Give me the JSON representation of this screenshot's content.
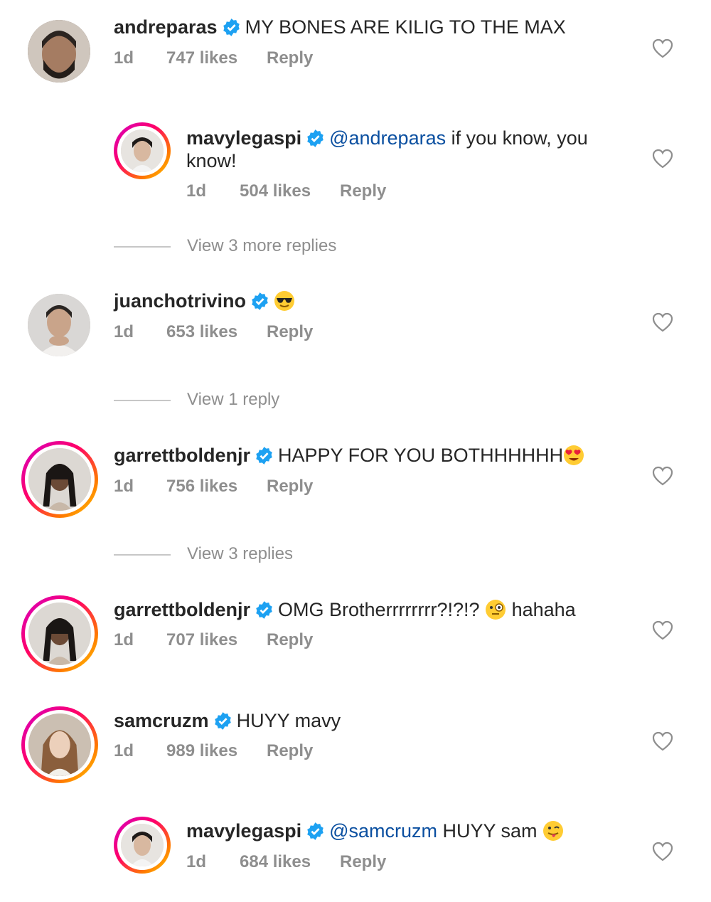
{
  "comments": [
    {
      "username": "andreparas",
      "text": "MY BONES ARE KILIG TO THE MAX",
      "time": "1d",
      "likes": "747 likes",
      "reply": "Reply",
      "avatar": "avatar-andreparas"
    },
    {
      "username": "mavylegaspi",
      "mention": "@andreparas",
      "text": " if you know, you know!",
      "time": "1d",
      "likes": "504 likes",
      "reply": "Reply",
      "avatar": "avatar-mavylegaspi"
    },
    {
      "username": "juanchotrivino",
      "emoji": "sunglasses-emoji",
      "time": "1d",
      "likes": "653 likes",
      "reply": "Reply",
      "avatar": "avatar-juanchotrivino"
    },
    {
      "username": "garrettboldenjr",
      "text": "HAPPY FOR YOU BOTHHHHHH",
      "emoji": "heart-eyes-emoji",
      "time": "1d",
      "likes": "756 likes",
      "reply": "Reply",
      "avatar": "avatar-garrettboldenjr"
    },
    {
      "username": "garrettboldenjr",
      "text": "OMG Brotherrrrrrrr?!?!? ",
      "emoji": "monocle-emoji",
      "text2": " hahaha",
      "time": "1d",
      "likes": "707 likes",
      "reply": "Reply",
      "avatar": "avatar-garrettboldenjr"
    },
    {
      "username": "samcruzm",
      "text": "HUYY mavy",
      "time": "1d",
      "likes": "989 likes",
      "reply": "Reply",
      "avatar": "avatar-samcruzm"
    },
    {
      "username": "mavylegaspi",
      "mention": "@samcruzm",
      "text": " HUYY sam ",
      "emoji": "winking-tongue-emoji",
      "time": "1d",
      "likes": "684 likes",
      "reply": "Reply",
      "avatar": "avatar-mavylegaspi"
    }
  ],
  "view_replies": [
    "View 3 more replies",
    "View 1 reply",
    "View 3 replies"
  ],
  "colors": {
    "verified": "#1da1f2",
    "muted": "#8e8e8e",
    "mention": "#0a4fa0"
  },
  "icons": {
    "verified": "verified-badge-icon",
    "like": "heart-outline-icon"
  }
}
